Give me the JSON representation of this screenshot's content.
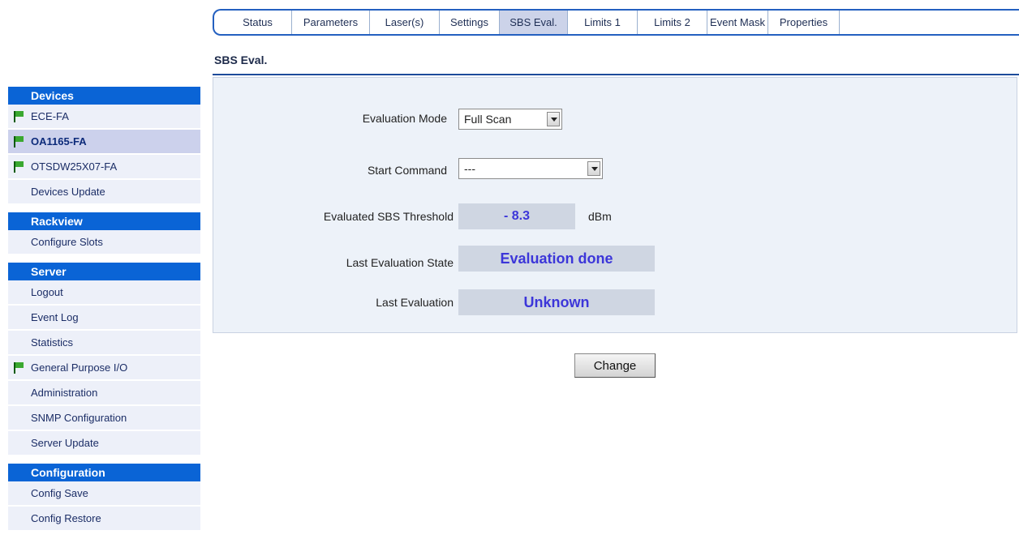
{
  "tabs": [
    {
      "label": "Status"
    },
    {
      "label": "Parameters"
    },
    {
      "label": "Laser(s)"
    },
    {
      "label": "Settings"
    },
    {
      "label": "SBS Eval."
    },
    {
      "label": "Limits 1"
    },
    {
      "label": "Limits 2"
    },
    {
      "label": "Event Mask"
    },
    {
      "label": "Properties"
    }
  ],
  "active_tab": "SBS Eval.",
  "sidebar": {
    "devices": {
      "header": "Devices",
      "items": [
        {
          "label": "ECE-FA",
          "icon": "green-flag-icon"
        },
        {
          "label": "OA1165-FA",
          "icon": "green-flag-icon",
          "selected": true
        },
        {
          "label": "OTSDW25X07-FA",
          "icon": "green-flag-icon"
        },
        {
          "label": "Devices Update"
        }
      ]
    },
    "rackview": {
      "header": "Rackview",
      "items": [
        {
          "label": "Configure Slots"
        }
      ]
    },
    "server": {
      "header": "Server",
      "items": [
        {
          "label": "Logout"
        },
        {
          "label": "Event Log"
        },
        {
          "label": "Statistics"
        },
        {
          "label": "General Purpose I/O",
          "icon": "green-flag-icon"
        },
        {
          "label": "Administration"
        },
        {
          "label": "SNMP Configuration"
        },
        {
          "label": "Server Update"
        }
      ]
    },
    "configuration": {
      "header": "Configuration",
      "items": [
        {
          "label": "Config Save"
        },
        {
          "label": "Config Restore"
        }
      ]
    }
  },
  "main": {
    "title": "SBS Eval.",
    "evaluation_mode": {
      "label": "Evaluation Mode",
      "value": "Full Scan"
    },
    "start_command": {
      "label": "Start Command",
      "value": "---"
    },
    "sbs_threshold": {
      "label": "Evaluated SBS Threshold",
      "value": "- 8.3",
      "unit": "dBm"
    },
    "last_state": {
      "label": "Last Evaluation State",
      "value": "Evaluation done"
    },
    "last_eval": {
      "label": "Last Evaluation",
      "value": "Unknown"
    },
    "change_button": "Change"
  },
  "colors": {
    "accent": "#0a64d6",
    "value_text": "#3c36d9",
    "flag_green": "#3aa830"
  }
}
